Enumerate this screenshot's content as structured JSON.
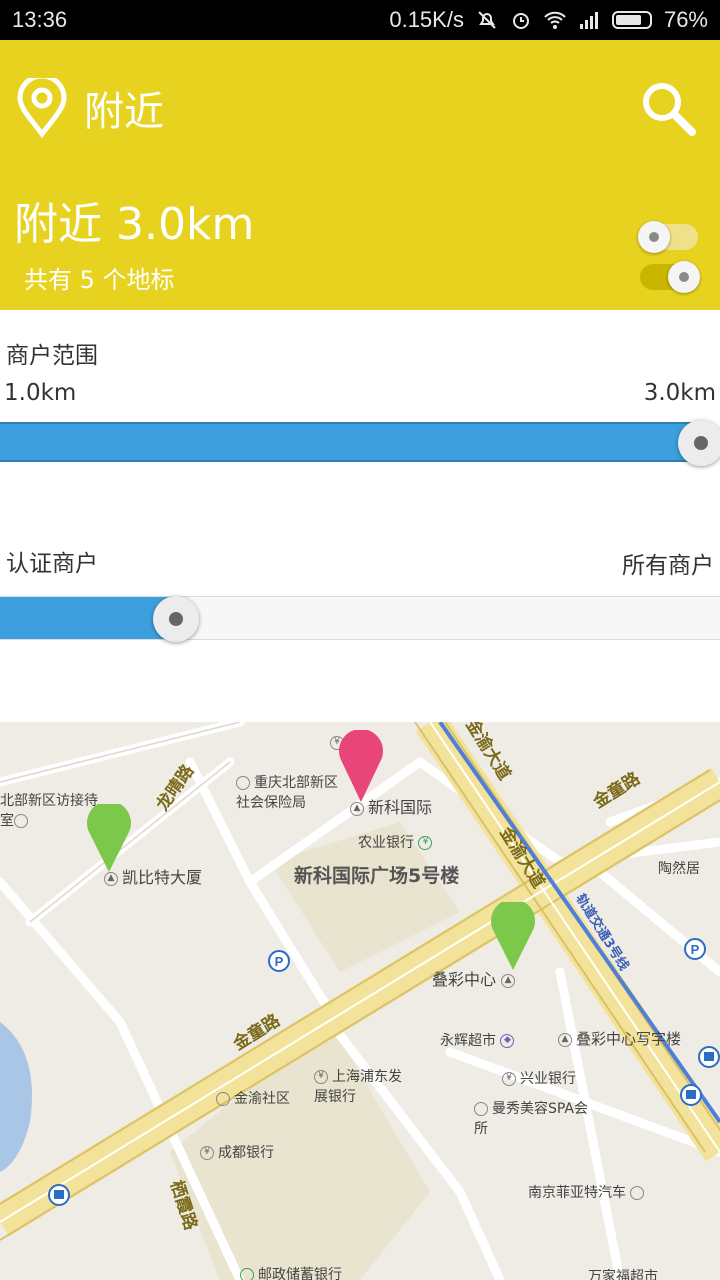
{
  "status_bar": {
    "time": "13:36",
    "network_speed": "0.15K/s",
    "battery": "76%",
    "icons": [
      "mute-icon",
      "alarm-icon",
      "wifi-icon",
      "signal-icon",
      "battery-icon"
    ]
  },
  "header": {
    "title": "附近",
    "radius_title": "附近 3.0km",
    "landmark_count": "共有 5 个地标",
    "bg_color": "#e6d21f",
    "toggle_1_on": false,
    "toggle_2_on": true
  },
  "range": {
    "label": "商户范围",
    "min_label": "1.0km",
    "max_label": "3.0km",
    "value_fraction": 1.0
  },
  "merchant_type": {
    "left_label": "认证商户",
    "right_label": "所有商户",
    "value_fraction": 0.25
  },
  "map": {
    "roads": [
      "龙晴路",
      "金渝大道",
      "金童路",
      "金渝大道",
      "金童路",
      "栖霞路"
    ],
    "areas": [
      "新科国际广场5号楼"
    ],
    "pois": [
      "银行",
      "重庆北部新区社会保险局",
      "新科国际",
      "北部新区访接待室",
      "农业银行",
      "凯比特大厦",
      "陶然居",
      "叠彩中心",
      "永辉超市",
      "叠彩中心写字楼",
      "上海浦东发展银行",
      "兴业银行",
      "金渝社区",
      "曼秀美容SPA会所",
      "成都银行",
      "南京菲亚特汽车",
      "邮政储蓄银行",
      "万家福超市"
    ],
    "metro_label": "轨道交通3号线",
    "pin_colors": {
      "selected": "#e8457a",
      "normal": "#7cc84a"
    }
  }
}
